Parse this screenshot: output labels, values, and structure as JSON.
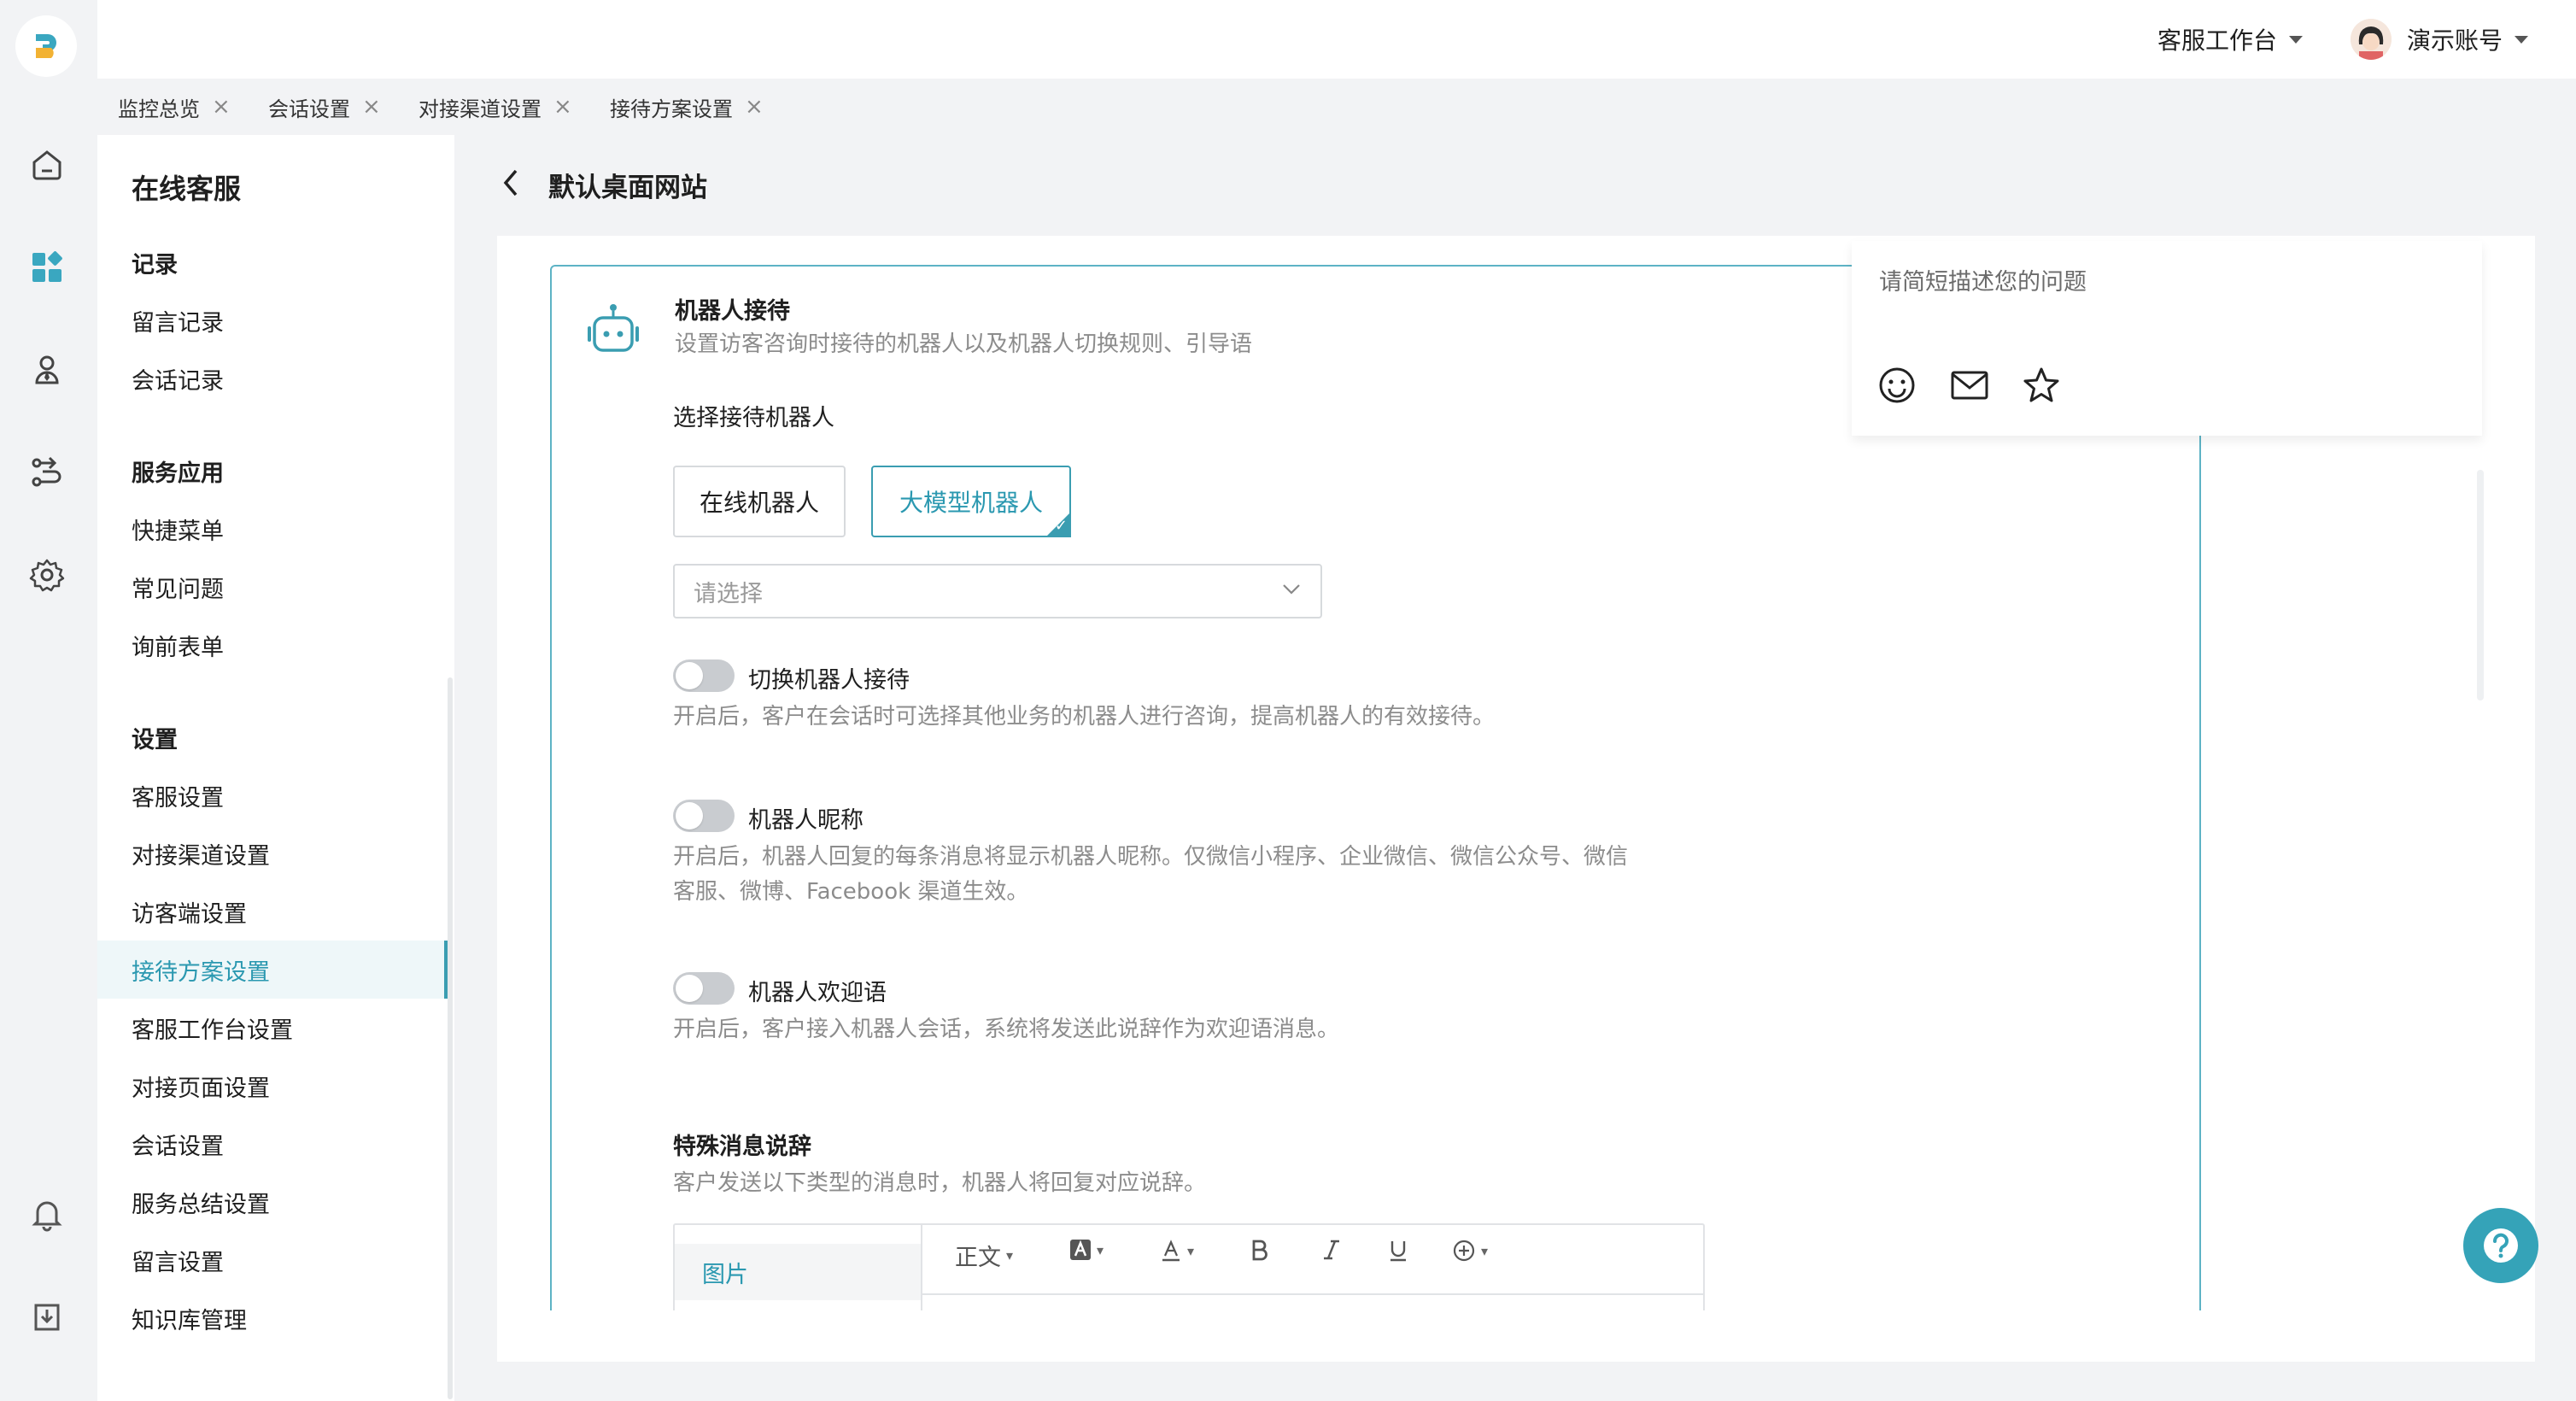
{
  "header": {
    "workspace_label": "客服工作台",
    "account_label": "演示账号"
  },
  "tabs": [
    {
      "label": "监控总览"
    },
    {
      "label": "会话设置"
    },
    {
      "label": "对接渠道设置"
    },
    {
      "label": "接待方案设置"
    }
  ],
  "sidebar": {
    "title": "在线客服",
    "sections": [
      {
        "heading": "记录",
        "items": [
          "留言记录",
          "会话记录"
        ]
      },
      {
        "heading": "服务应用",
        "items": [
          "快捷菜单",
          "常见问题",
          "询前表单"
        ]
      },
      {
        "heading": "设置",
        "items": [
          "客服设置",
          "对接渠道设置",
          "访客端设置",
          "接待方案设置",
          "客服工作台设置",
          "对接页面设置",
          "会话设置",
          "服务总结设置",
          "留言设置",
          "知识库管理"
        ]
      }
    ],
    "active_item": "接待方案设置"
  },
  "page": {
    "title": "默认桌面网站"
  },
  "robot_card": {
    "title": "机器人接待",
    "subtitle": "设置访客咨询时接待的机器人以及机器人切换规则、引导语",
    "choose_label": "选择接待机器人",
    "options": [
      "在线机器人",
      "大模型机器人"
    ],
    "selected_option": "大模型机器人",
    "select_placeholder": "请选择",
    "switch_title": "切换机器人接待",
    "switch_desc": "开启后，客户在会话时可选择其他业务的机器人进行咨询，提高机器人的有效接待。",
    "switch_on": false,
    "nickname_title": "机器人昵称",
    "nickname_desc_1": "开启后，机器人回复的每条消息将显示机器人昵称。仅微信小程序、企业微信、微信公众号、微信",
    "nickname_desc_2": "客服、微博、Facebook 渠道生效。",
    "nickname_on": false,
    "welcome_title": "机器人欢迎语",
    "welcome_desc": "开启后，客户接入机器人会话，系统将发送此说辞作为欢迎语消息。",
    "welcome_on": false,
    "special_title": "特殊消息说辞",
    "special_desc": "客户发送以下类型的消息时，机器人将回复对应说辞。",
    "editor_tab": "图片",
    "editor_format": "正文"
  },
  "chat_preview": {
    "placeholder": "请简短描述您的问题"
  },
  "colors": {
    "accent": "#3a9db1",
    "accent_text": "#2a98b0",
    "help_button": "#35a3b8"
  }
}
